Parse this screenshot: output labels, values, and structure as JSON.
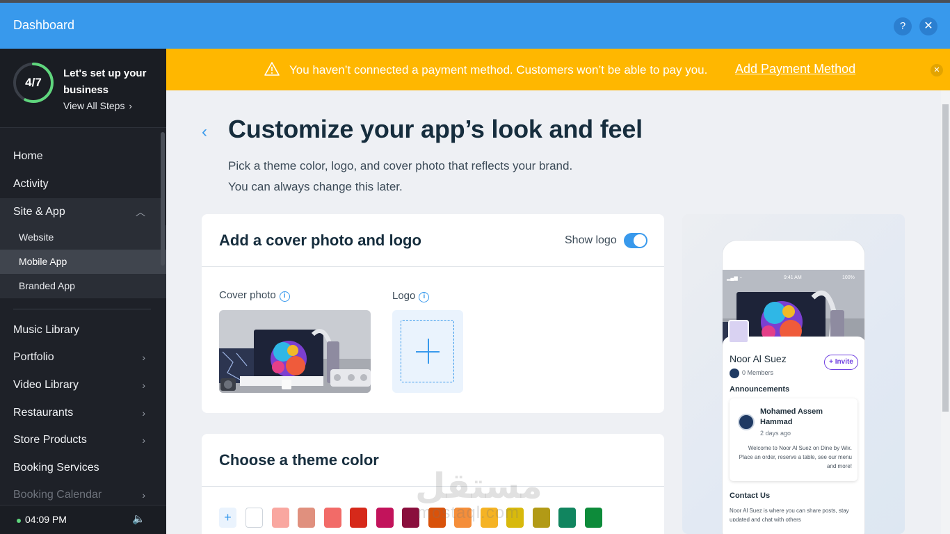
{
  "topbar": {
    "title": "Dashboard",
    "help_icon": "?",
    "close_icon": "✕"
  },
  "setup": {
    "progress": "4/7",
    "progress_fraction": 0.57,
    "title": "Let's set up your business",
    "link": "View All Steps"
  },
  "sidebar": {
    "items": [
      {
        "label": "Home"
      },
      {
        "label": "Activity"
      },
      {
        "label": "Site & App"
      },
      {
        "label": "Music Library"
      },
      {
        "label": "Portfolio"
      },
      {
        "label": "Video Library"
      },
      {
        "label": "Restaurants"
      },
      {
        "label": "Store Products"
      },
      {
        "label": "Booking Services"
      },
      {
        "label": "Booking Calendar"
      }
    ],
    "sub_items": [
      {
        "label": "Website"
      },
      {
        "label": "Mobile App",
        "active": true
      },
      {
        "label": "Branded App"
      }
    ],
    "time": "04:09 PM"
  },
  "banner": {
    "text": "You haven’t connected a payment method. Customers won’t be able to pay you.",
    "link": "Add Payment Method",
    "color": "#ffb700"
  },
  "main": {
    "title": "Customize your app’s look and feel",
    "subtitle_line1": "Pick a theme color, logo, and cover photo that reflects your brand.",
    "subtitle_line2": "You can always change this later."
  },
  "cover_card": {
    "title": "Add a cover photo and logo",
    "show_logo_label": "Show logo",
    "show_logo_on": true,
    "cover_label": "Cover photo",
    "logo_label": "Logo"
  },
  "theme_card": {
    "title": "Choose a theme color",
    "add": "+",
    "colors": [
      "#ffffff",
      "#f9a7a0",
      "#e0907e",
      "#f26b68",
      "#d6291a",
      "#c2135b",
      "#8a0f3d",
      "#d9520a",
      "#f58e3a",
      "#f5b324",
      "#d8b90c",
      "#b29a16",
      "#11855f",
      "#0d8b3a"
    ]
  },
  "preview": {
    "status_left": "",
    "status_time": "9:41 AM",
    "status_right": "100%",
    "name": "Noor Al Suez",
    "invite": "+ Invite",
    "members": "0 Members",
    "announcements": "Announcements",
    "post_author": "Mohamed Assem Hammad",
    "post_time": "2 days ago",
    "post_text": "Welcome to Noor Al Suez on Dine by Wix. Place an order, reserve a table, see our menu and more!",
    "contact_title": "Contact Us",
    "contact_text": "Noor Al Suez is where you can share posts, stay updated and chat with others"
  },
  "watermark": {
    "main": "مستقل",
    "sub": "mostaql.com"
  },
  "accent": "#3899ec"
}
